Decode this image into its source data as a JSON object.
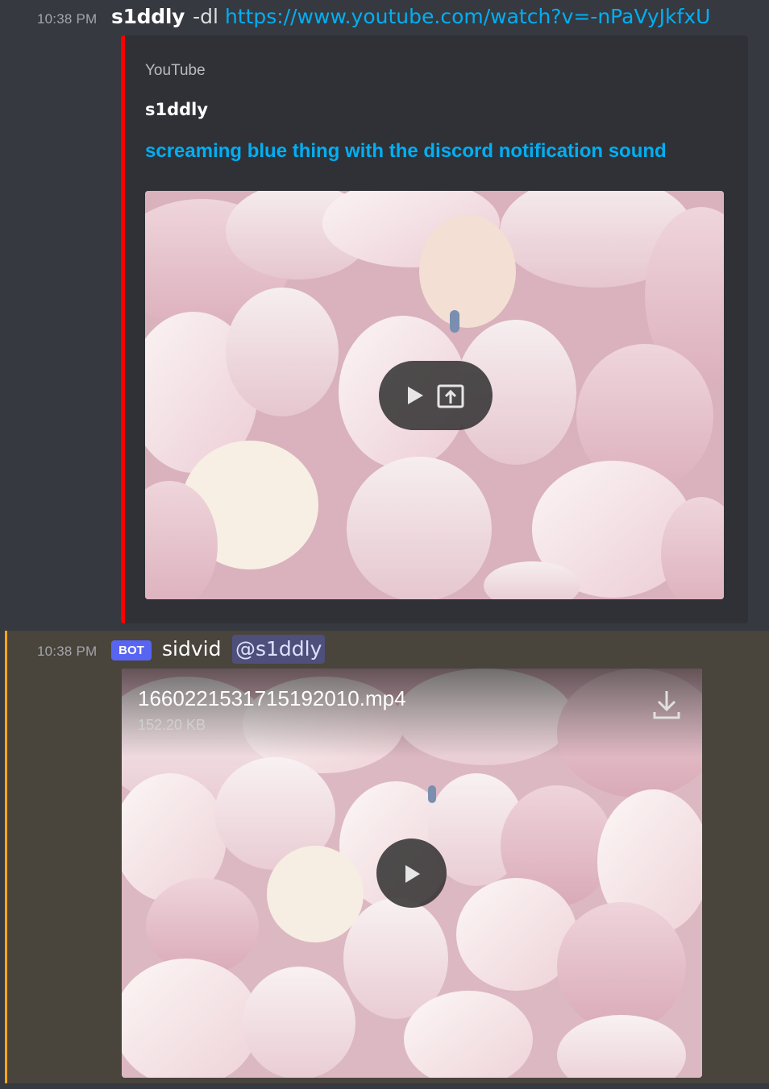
{
  "message1": {
    "timestamp": "10:38 PM",
    "username": "s1ddly",
    "command": "-dl",
    "link": "https://www.youtube.com/watch?v=-nPaVyJkfxU",
    "embed": {
      "provider": "YouTube",
      "author": "s1ddly",
      "title": "screaming blue thing with the discord notification sound",
      "accent_color": "#ff0000"
    }
  },
  "message2": {
    "timestamp": "10:38 PM",
    "bot_tag": "BOT",
    "username": "sidvid",
    "mention": "@s1ddly",
    "attachment": {
      "filename": "1660221531715192010.mp4",
      "size": "152.20 KB"
    },
    "highlight_color": "#faa61a"
  },
  "colors": {
    "background": "#36393f",
    "embed_background": "#2f3136",
    "link": "#00aff4",
    "bot_tag": "#5865f2"
  },
  "icons": [
    "play-icon",
    "open-external-icon",
    "download-icon"
  ]
}
